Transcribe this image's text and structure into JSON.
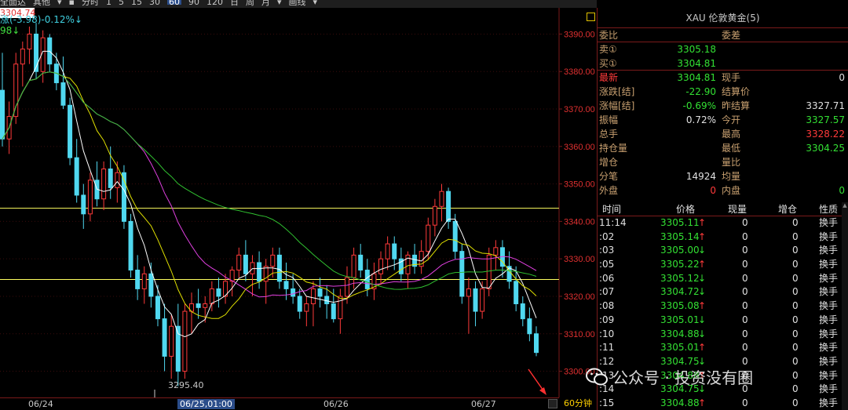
{
  "toolbar": {
    "items": [
      "全面达",
      "其他",
      "▾",
      "▪",
      "分时",
      "1",
      "5",
      "15",
      "30",
      "60",
      "90",
      "120",
      "日",
      "周",
      "月",
      "▾",
      "画线",
      "▾"
    ],
    "active_period": "60"
  },
  "indicators": {
    "line1": "涨(-3.98)-0.12%↓",
    "line2": "98↓"
  },
  "price_axis": {
    "ticks": [
      "3390.00",
      "3380.00",
      "3370.00",
      "3360.00",
      "3350.00",
      "3340.00",
      "3330.00",
      "3320.00",
      "3310.00",
      "3300.00"
    ],
    "last_price_tag": "3304.74",
    "low_label": "3295.40"
  },
  "date_axis": {
    "labels": [
      "06/24",
      "06/25,01:00",
      "06/26",
      "06/27"
    ],
    "active_label": "06/25,01:00",
    "period": "60分钟"
  },
  "colors": {
    "up": "#ff3a3a",
    "down": "#50d8f0",
    "ma5": "#ffffff",
    "ma10": "#e0e000",
    "ma20": "#e040e0",
    "ma60": "#30c030",
    "hline": "#ffff60"
  },
  "chart_data": {
    "type": "candlestick",
    "ylim": [
      3293,
      3397
    ],
    "ma_series": [
      "MA5",
      "MA10",
      "MA20",
      "MA60"
    ],
    "reference_lines": [
      3343.5,
      3324.5
    ],
    "candles": [
      [
        3375,
        3385,
        3360,
        3362
      ],
      [
        3362,
        3372,
        3358,
        3368
      ],
      [
        3368,
        3385,
        3366,
        3382
      ],
      [
        3382,
        3388,
        3376,
        3386
      ],
      [
        3386,
        3392,
        3382,
        3390
      ],
      [
        3390,
        3393,
        3378,
        3380
      ],
      [
        3380,
        3391,
        3377,
        3389
      ],
      [
        3389,
        3390,
        3380,
        3382
      ],
      [
        3382,
        3385,
        3375,
        3377
      ],
      [
        3377,
        3384,
        3370,
        3371
      ],
      [
        3371,
        3373,
        3355,
        3357
      ],
      [
        3357,
        3362,
        3345,
        3347
      ],
      [
        3347,
        3350,
        3338,
        3342
      ],
      [
        3342,
        3353,
        3340,
        3351
      ],
      [
        3351,
        3356,
        3344,
        3346
      ],
      [
        3346,
        3356,
        3343,
        3354
      ],
      [
        3354,
        3360,
        3346,
        3349
      ],
      [
        3349,
        3356,
        3345,
        3353
      ],
      [
        3353,
        3355,
        3338,
        3340
      ],
      [
        3340,
        3342,
        3325,
        3327
      ],
      [
        3327,
        3331,
        3319,
        3322
      ],
      [
        3322,
        3328,
        3318,
        3326
      ],
      [
        3326,
        3329,
        3317,
        3320
      ],
      [
        3320,
        3323,
        3312,
        3314
      ],
      [
        3314,
        3318,
        3300,
        3304
      ],
      [
        3304,
        3315,
        3298,
        3312
      ],
      [
        3312,
        3318,
        3296,
        3300
      ],
      [
        3300,
        3318,
        3298,
        3316
      ],
      [
        3316,
        3321,
        3310,
        3318
      ],
      [
        3318,
        3322,
        3314,
        3317
      ],
      [
        3317,
        3320,
        3313,
        3318
      ],
      [
        3318,
        3324,
        3316,
        3322
      ],
      [
        3322,
        3325,
        3317,
        3320
      ],
      [
        3320,
        3326,
        3318,
        3324
      ],
      [
        3324,
        3328,
        3320,
        3327
      ],
      [
        3327,
        3333,
        3325,
        3331
      ],
      [
        3331,
        3335,
        3324,
        3326
      ],
      [
        3326,
        3331,
        3320,
        3329
      ],
      [
        3329,
        3332,
        3322,
        3324
      ],
      [
        3324,
        3330,
        3318,
        3328
      ],
      [
        3328,
        3333,
        3325,
        3331
      ],
      [
        3331,
        3333,
        3322,
        3324
      ],
      [
        3324,
        3329,
        3319,
        3322
      ],
      [
        3322,
        3326,
        3318,
        3320
      ],
      [
        3320,
        3322,
        3314,
        3316
      ],
      [
        3316,
        3320,
        3312,
        3318
      ],
      [
        3318,
        3324,
        3312,
        3322
      ],
      [
        3322,
        3325,
        3317,
        3320
      ],
      [
        3320,
        3323,
        3314,
        3318
      ],
      [
        3318,
        3322,
        3313,
        3314
      ],
      [
        3314,
        3322,
        3310,
        3320
      ],
      [
        3320,
        3328,
        3318,
        3325
      ],
      [
        3325,
        3333,
        3322,
        3331
      ],
      [
        3331,
        3334,
        3325,
        3327
      ],
      [
        3327,
        3330,
        3320,
        3322
      ],
      [
        3322,
        3329,
        3319,
        3326
      ],
      [
        3326,
        3332,
        3323,
        3330
      ],
      [
        3330,
        3336,
        3327,
        3334
      ],
      [
        3334,
        3336,
        3327,
        3330
      ],
      [
        3330,
        3333,
        3324,
        3326
      ],
      [
        3326,
        3332,
        3322,
        3331
      ],
      [
        3331,
        3334,
        3326,
        3328
      ],
      [
        3328,
        3335,
        3326,
        3332
      ],
      [
        3332,
        3341,
        3330,
        3339
      ],
      [
        3339,
        3346,
        3336,
        3344
      ],
      [
        3344,
        3350,
        3340,
        3348
      ],
      [
        3348,
        3349,
        3338,
        3340
      ],
      [
        3340,
        3342,
        3330,
        3332
      ],
      [
        3332,
        3334,
        3318,
        3320
      ],
      [
        3320,
        3325,
        3310,
        3322
      ],
      [
        3322,
        3324,
        3312,
        3316
      ],
      [
        3316,
        3324,
        3314,
        3322
      ],
      [
        3322,
        3333,
        3320,
        3331
      ],
      [
        3331,
        3335,
        3327,
        3333
      ],
      [
        3333,
        3335,
        3325,
        3328
      ],
      [
        3328,
        3332,
        3322,
        3324
      ],
      [
        3324,
        3328,
        3316,
        3318
      ],
      [
        3318,
        3320,
        3312,
        3314
      ],
      [
        3314,
        3317,
        3308,
        3310
      ],
      [
        3310,
        3312,
        3304,
        3305
      ]
    ]
  },
  "quote": {
    "title": "XAU 伦敦黄金(5)",
    "weibi_label": "委比",
    "weicha_label": "委差",
    "sell_label": "卖①",
    "sell_price": "3305.18",
    "buy_label": "买①",
    "buy_price": "3304.81",
    "rows": [
      {
        "l1": "最新",
        "v1": "3304.81",
        "l2": "现手",
        "v2": "0"
      },
      {
        "l1": "涨跌[结]",
        "v1": "-22.90",
        "l2": "结算价",
        "v2": ""
      },
      {
        "l1": "涨幅[结]",
        "v1": "-0.69%",
        "l2": "昨结算",
        "v2": "3327.71"
      },
      {
        "l1": "振幅",
        "v1": "0.72%",
        "l2": "今开",
        "v2": "3327.57"
      },
      {
        "l1": "总手",
        "v1": "",
        "l2": "最高",
        "v2": "3328.22"
      },
      {
        "l1": "持仓量",
        "v1": "",
        "l2": "最低",
        "v2": "3304.25"
      },
      {
        "l1": "增仓",
        "v1": "",
        "l2": "量比",
        "v2": ""
      },
      {
        "l1": "分笔",
        "v1": "14924",
        "l2": "均量",
        "v2": ""
      },
      {
        "l1": "外盘",
        "v1": "0",
        "l2": "内盘",
        "v2": "0"
      }
    ]
  },
  "ticks": {
    "headers": [
      "时间",
      "价格",
      "现量",
      "增仓",
      "性质"
    ],
    "rows": [
      {
        "time": "11:14",
        "price": "3305.11",
        "dir": "↑",
        "vol": "0",
        "oi": "0",
        "kind": "换手"
      },
      {
        "time": ":02",
        "price": "3305.14",
        "dir": "↑",
        "vol": "0",
        "oi": "0",
        "kind": "换手"
      },
      {
        "time": ":03",
        "price": "3305.00",
        "dir": "↓",
        "vol": "0",
        "oi": "0",
        "kind": "换手"
      },
      {
        "time": ":05",
        "price": "3305.22",
        "dir": "↑",
        "vol": "0",
        "oi": "0",
        "kind": "换手"
      },
      {
        "time": ":06",
        "price": "3305.12",
        "dir": "↓",
        "vol": "0",
        "oi": "0",
        "kind": "换手"
      },
      {
        "time": ":07",
        "price": "3304.72",
        "dir": "↓",
        "vol": "0",
        "oi": "0",
        "kind": "换手"
      },
      {
        "time": ":08",
        "price": "3305.08",
        "dir": "↑",
        "vol": "0",
        "oi": "0",
        "kind": "换手"
      },
      {
        "time": ":09",
        "price": "3305.01",
        "dir": "↓",
        "vol": "0",
        "oi": "0",
        "kind": "换手"
      },
      {
        "time": ":10",
        "price": "3304.88",
        "dir": "↓",
        "vol": "0",
        "oi": "0",
        "kind": "换手"
      },
      {
        "time": ":11",
        "price": "3305.01",
        "dir": "↑",
        "vol": "0",
        "oi": "0",
        "kind": "换手"
      },
      {
        "time": ":12",
        "price": "3304.75",
        "dir": "↓",
        "vol": "0",
        "oi": "0",
        "kind": "换手"
      },
      {
        "time": ":13",
        "price": "3304.88",
        "dir": "↑",
        "vol": "0",
        "oi": "0",
        "kind": "换手"
      },
      {
        "time": ":14",
        "price": "3304.75",
        "dir": "↓",
        "vol": "0",
        "oi": "0",
        "kind": "换手"
      },
      {
        "time": ":15",
        "price": "3304.88",
        "dir": "↑",
        "vol": "0",
        "oi": "0",
        "kind": "换手"
      }
    ]
  },
  "watermark": {
    "text": "公众号 · 投资没有圈",
    "icon": "wechat-icon"
  }
}
